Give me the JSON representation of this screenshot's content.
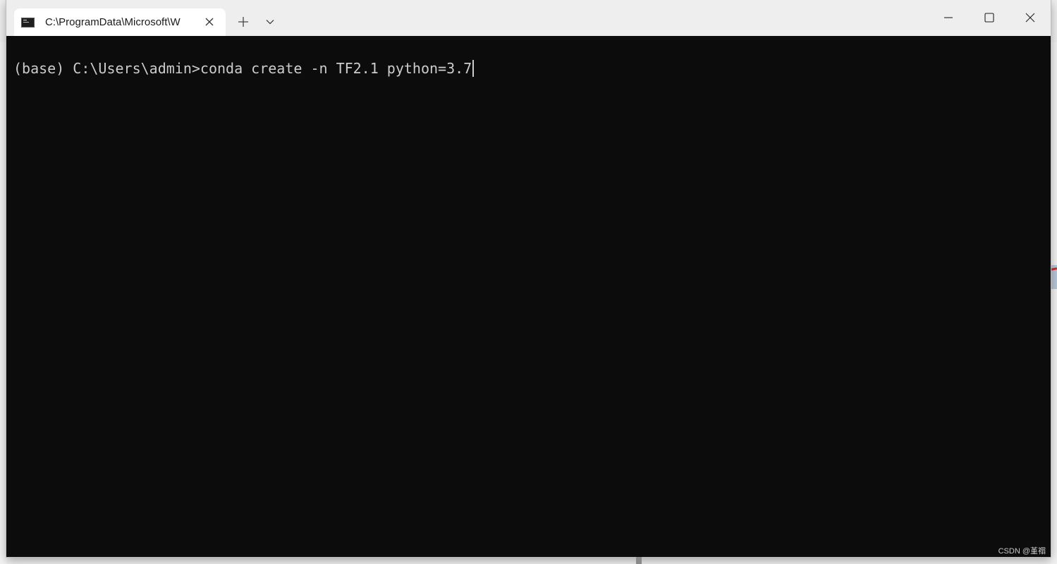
{
  "window": {
    "tab_title": "C:\\ProgramData\\Microsoft\\W",
    "controls": {
      "new_tab": "plus-icon",
      "dropdown": "chevron-down-icon",
      "minimize": "minimize-icon",
      "maximize": "maximize-icon",
      "close": "close-icon"
    }
  },
  "terminal": {
    "prompt": "(base) C:\\Users\\admin>",
    "command": "conda create -n TF2.1 python=3.7"
  },
  "watermark": "CSDN @堇禤",
  "colors": {
    "terminal_bg": "#0c0c0c",
    "terminal_fg": "#cccccc",
    "titlebar_bg": "#eeeeee",
    "tab_bg": "#ffffff"
  }
}
